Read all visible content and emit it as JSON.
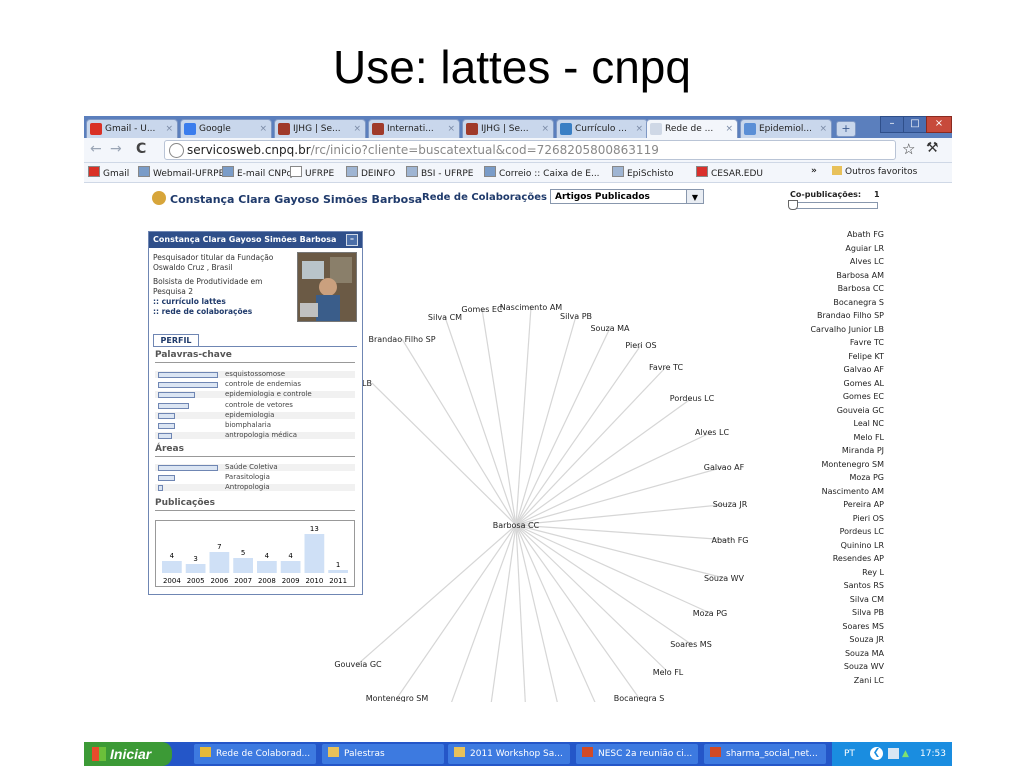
{
  "slide": {
    "title": "Use: lattes - cnpq"
  },
  "browser": {
    "tabs": [
      {
        "label": "Gmail - U...",
        "icon": "gmail-icon",
        "active": false
      },
      {
        "label": "Google",
        "icon": "google-icon",
        "active": false
      },
      {
        "label": "IJHG | Se...",
        "icon": "ijhg-icon",
        "active": false
      },
      {
        "label": "Internati...",
        "icon": "ijhg-icon",
        "active": false
      },
      {
        "label": "IJHG | Se...",
        "icon": "ijhg-icon",
        "active": false
      },
      {
        "label": "Currículo ...",
        "icon": "lattes-icon",
        "active": false
      },
      {
        "label": "Rede de ...",
        "icon": "loading-icon",
        "active": true
      },
      {
        "label": "Epidemiol...",
        "icon": "globe-icon",
        "active": false
      }
    ],
    "url_host": "servicosweb.cnpq.br",
    "url_path": "/rc/inicio?cliente=buscatextual&cod=7268205800863119",
    "bookmarks": [
      {
        "label": "Gmail",
        "icon": "gmail-icon"
      },
      {
        "label": "Webmail-UFRPE",
        "icon": "mail-icon"
      },
      {
        "label": "E-mail CNPq",
        "icon": "mail-icon"
      },
      {
        "label": "UFRPE",
        "icon": "page-icon"
      },
      {
        "label": "DEINFO",
        "icon": "globe-icon"
      },
      {
        "label": "BSI - UFRPE",
        "icon": "globe-icon"
      },
      {
        "label": "Correio :: Caixa de E...",
        "icon": "mail-icon"
      },
      {
        "label": "EpiSchisto",
        "icon": "globe-icon"
      },
      {
        "label": "CESAR.EDU",
        "icon": "flame-icon"
      }
    ],
    "bookmarks_more": "»",
    "other_bookmarks": "Outros favoritos"
  },
  "app": {
    "header_name": "Constança Clara Gayoso Simões Barbosa",
    "network_label": "Rede de Colaborações em",
    "network_select": "Artigos Publicados",
    "copub_label": "Co-publicações:",
    "copub_value": "1"
  },
  "profile": {
    "title": "Constança Clara Gayoso Simões Barbosa",
    "line1": "Pesquisador titular da Fundação Oswaldo Cruz , Brasil",
    "line2": "Bolsista de Produtividade em Pesquisa 2",
    "link1": ":: currículo lattes",
    "link2": ":: rede de colaborações",
    "tab": "PERFIL",
    "keywords_title": "Palavras-chave",
    "keywords": [
      {
        "label": "esquistossomose",
        "value": 1.0
      },
      {
        "label": "controle de endemias",
        "value": 1.0
      },
      {
        "label": "epidemiologia e controle",
        "value": 0.6
      },
      {
        "label": "controle de vetores",
        "value": 0.5
      },
      {
        "label": "epidemiologia",
        "value": 0.25
      },
      {
        "label": "biomphalaria",
        "value": 0.25
      },
      {
        "label": "antropologia médica",
        "value": 0.2
      }
    ],
    "areas_title": "Áreas",
    "areas": [
      {
        "label": "Saúde Coletiva",
        "value": 1.0
      },
      {
        "label": "Parasitologia",
        "value": 0.25
      },
      {
        "label": "Antropologia",
        "value": 0.05
      }
    ],
    "pubs_title": "Publicações"
  },
  "chart_data": {
    "type": "bar",
    "title": "Publicações",
    "categories": [
      "2004",
      "2005",
      "2006",
      "2007",
      "2008",
      "2009",
      "2010",
      "2011"
    ],
    "values": [
      4,
      3,
      7,
      5,
      4,
      4,
      13,
      1
    ],
    "ylim": [
      0,
      14
    ]
  },
  "network": {
    "center": "Barbosa CC",
    "nodes": [
      "Silva CM",
      "Gomes EC",
      "Nascimento AM",
      "Silva PB",
      "Souza MA",
      "Brandao Filho SP",
      "Pieri OS",
      "Favre TC",
      "Carvalho Junior LB",
      "Pordeus LC",
      "Alves LC",
      "Galvao AF",
      "Souza JR",
      "Abath FG",
      "Souza WV",
      "Moza PG",
      "Soares MS",
      "Melo FL",
      "Bocanegra S",
      "Santos RS",
      "Gomes AL",
      "Aguiar LR",
      "Quinino LR",
      "Resendes AP",
      "Montenegro SM",
      "Gouveia GC"
    ]
  },
  "authors": [
    "Abath FG",
    "Aguiar LR",
    "Alves LC",
    "Barbosa AM",
    "Barbosa CC",
    "Bocanegra S",
    "Brandao Filho SP",
    "Carvalho Junior LB",
    "Favre TC",
    "Felipe KT",
    "Galvao AF",
    "Gomes AL",
    "Gomes EC",
    "Gouveia GC",
    "Leal NC",
    "Melo FL",
    "Miranda PJ",
    "Montenegro SM",
    "Moza PG",
    "Nascimento AM",
    "Pereira AP",
    "Pieri OS",
    "Pordeus LC",
    "Quinino LR",
    "Resendes AP",
    "Rey L",
    "Santos RS",
    "Silva CM",
    "Silva PB",
    "Soares MS",
    "Souza JR",
    "Souza MA",
    "Souza WV",
    "Zani LC"
  ],
  "taskbar": {
    "start": "Iniciar",
    "items": [
      {
        "label": "Rede de Colaborad...",
        "icon": "chrome-icon"
      },
      {
        "label": "Palestras",
        "icon": "folder-icon"
      },
      {
        "label": "2011 Workshop Sa...",
        "icon": "folder-icon"
      },
      {
        "label": "NESC 2a reunião ci...",
        "icon": "ppt-icon"
      },
      {
        "label": "sharma_social_net...",
        "icon": "ppt-icon"
      }
    ],
    "lang": "PT",
    "clock": "17:53"
  },
  "colors": {
    "taskbar": "#2456c8",
    "start": "#3c9a36",
    "header": "#1f3a6b",
    "edge": "#d6d6d6"
  }
}
